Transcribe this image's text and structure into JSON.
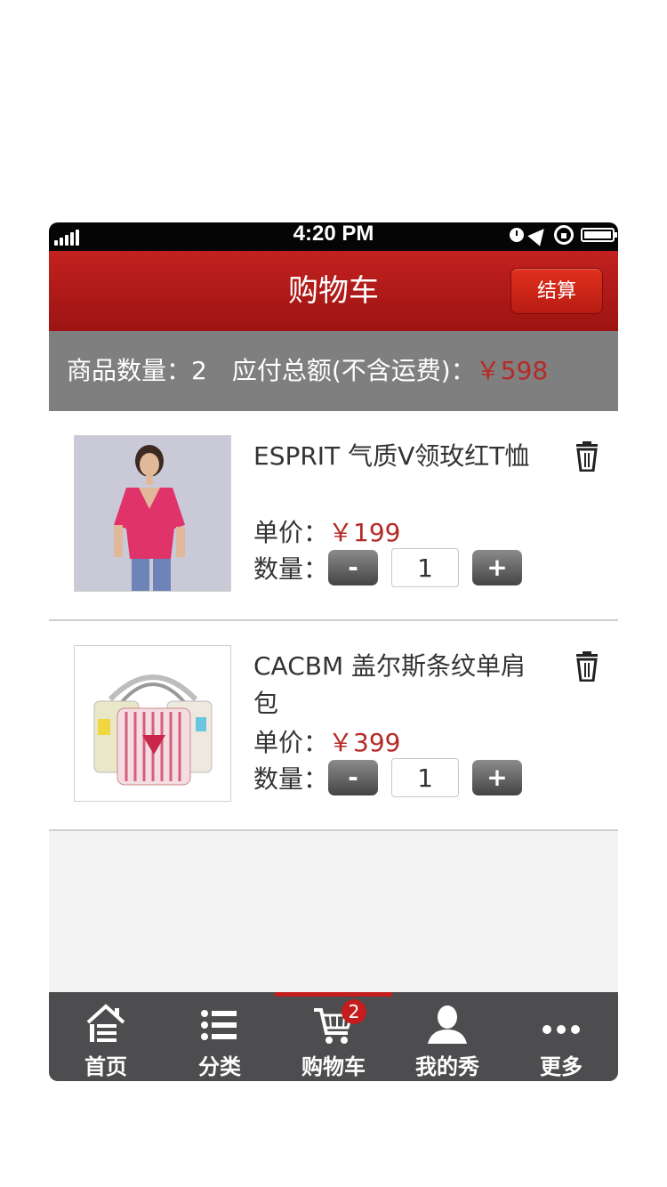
{
  "status_bar": {
    "time": "4:20 PM"
  },
  "header": {
    "title": "购物车",
    "checkout_label": "结算"
  },
  "summary": {
    "count_label": "商品数量：",
    "count": "2",
    "total_label": "应付总额(不含运费)：",
    "total": "￥598"
  },
  "items": [
    {
      "name": "ESPRIT  气质V领玫红T恤",
      "price_label": "单价：",
      "price": "￥199",
      "qty_label": "数量：",
      "qty": "1",
      "minus": "-",
      "plus": "+",
      "image": "pink-tshirt-photo"
    },
    {
      "name": "CACBM 盖尔斯条纹单肩包",
      "price_label": "单价：",
      "price": "￥399",
      "qty_label": "数量：",
      "qty": "1",
      "minus": "-",
      "plus": "+",
      "image": "striped-shoulder-bag-photo"
    }
  ],
  "tabbar": {
    "tabs": [
      {
        "label": "首页",
        "icon": "home-icon"
      },
      {
        "label": "分类",
        "icon": "list-icon"
      },
      {
        "label": "购物车",
        "icon": "cart-icon",
        "active": true,
        "badge": "2"
      },
      {
        "label": "我的秀",
        "icon": "user-icon"
      },
      {
        "label": "更多",
        "icon": "more-icon"
      }
    ]
  },
  "colors": {
    "accent_red": "#c2211f",
    "price_red": "#b52a27",
    "tabbar_bg": "#4d4d4f"
  }
}
